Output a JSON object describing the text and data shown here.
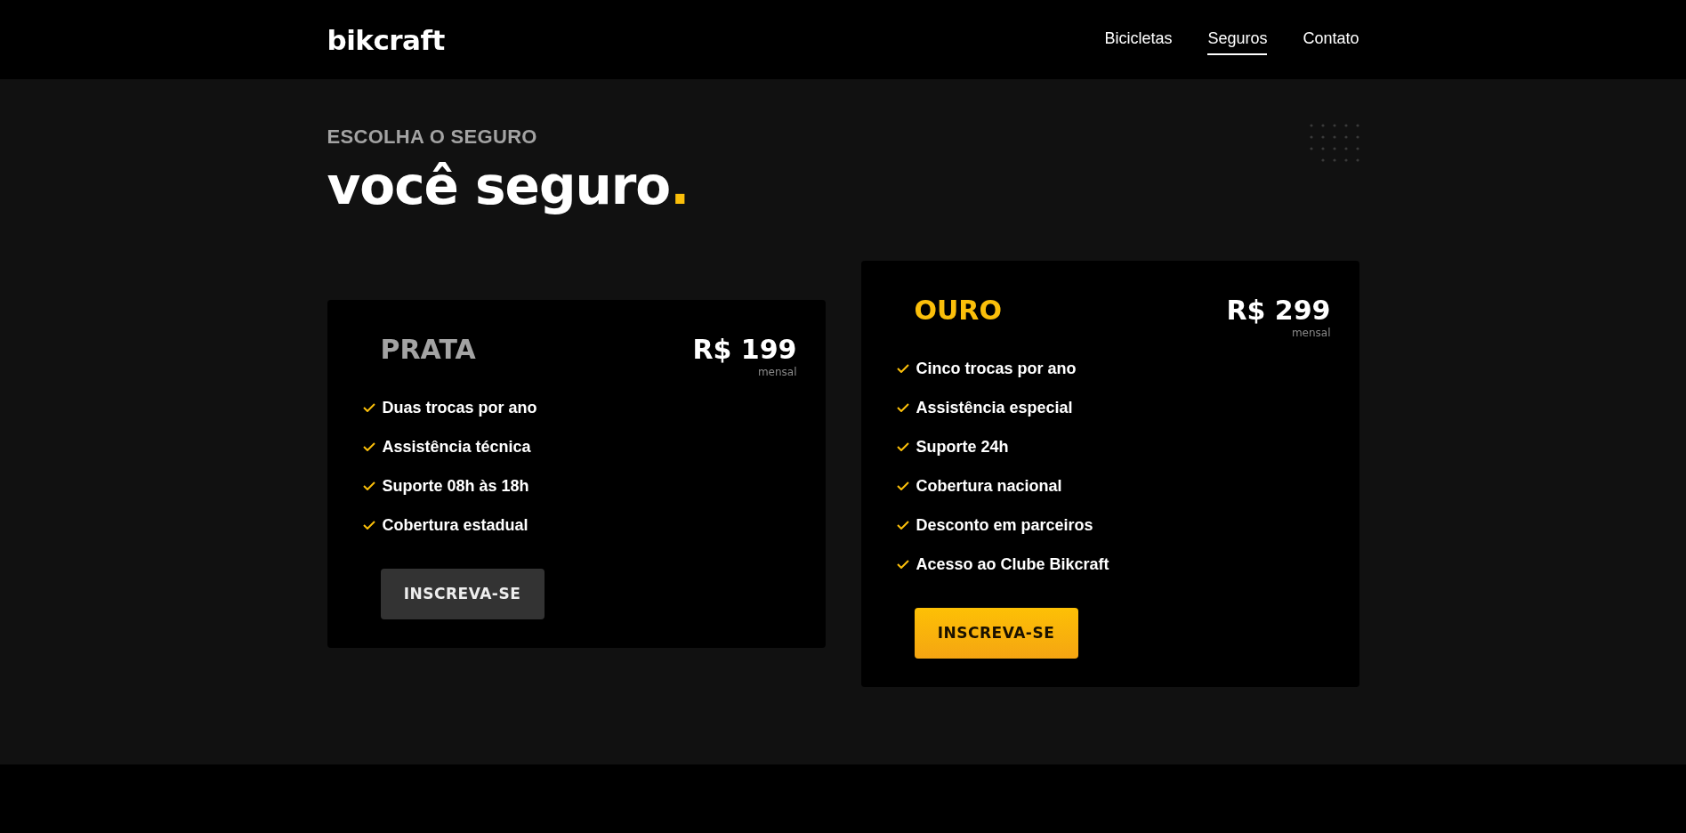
{
  "header": {
    "logo": "bikcraft",
    "nav": [
      {
        "label": "Bicicletas",
        "selected": false
      },
      {
        "label": "Seguros",
        "selected": true
      },
      {
        "label": "Contato",
        "selected": false
      }
    ]
  },
  "intro": {
    "subtitle": "ESCOLHA O SEGURO",
    "title": "você seguro",
    "title_dot": "."
  },
  "plans": [
    {
      "name": "PRATA",
      "featured": false,
      "price": "R$ 199",
      "period": "mensal",
      "features": [
        "Duas trocas por ano",
        "Assistência técnica",
        "Suporte 08h às 18h",
        "Cobertura estadual"
      ],
      "button": "INSCREVA-SE"
    },
    {
      "name": "OURO",
      "featured": true,
      "price": "R$ 299",
      "period": "mensal",
      "features": [
        "Cinco trocas por ano",
        "Assistência especial",
        "Suporte 24h",
        "Cobertura nacional",
        "Desconto em parceiros",
        "Acesso ao Clube Bikcraft"
      ],
      "button": "INSCREVA-SE"
    }
  ]
}
